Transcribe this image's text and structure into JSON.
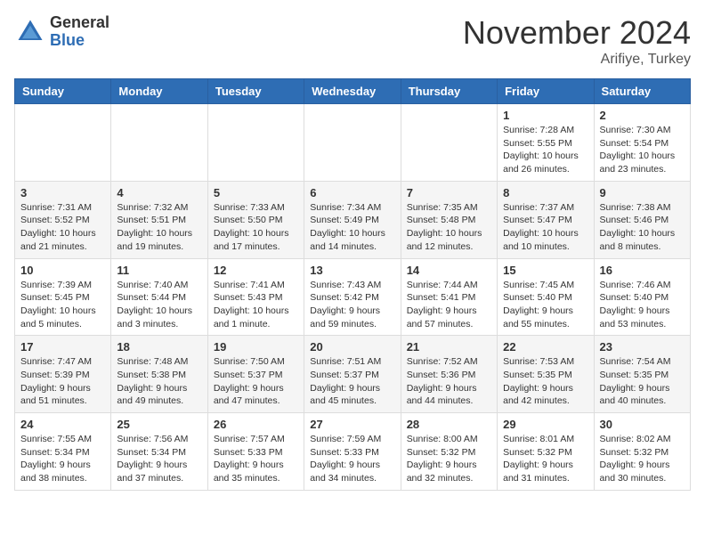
{
  "header": {
    "logo_general": "General",
    "logo_blue": "Blue",
    "month_title": "November 2024",
    "location": "Arifiye, Turkey"
  },
  "days_of_week": [
    "Sunday",
    "Monday",
    "Tuesday",
    "Wednesday",
    "Thursday",
    "Friday",
    "Saturday"
  ],
  "weeks": [
    [
      {
        "day": "",
        "info": ""
      },
      {
        "day": "",
        "info": ""
      },
      {
        "day": "",
        "info": ""
      },
      {
        "day": "",
        "info": ""
      },
      {
        "day": "",
        "info": ""
      },
      {
        "day": "1",
        "info": "Sunrise: 7:28 AM\nSunset: 5:55 PM\nDaylight: 10 hours and 26 minutes."
      },
      {
        "day": "2",
        "info": "Sunrise: 7:30 AM\nSunset: 5:54 PM\nDaylight: 10 hours and 23 minutes."
      }
    ],
    [
      {
        "day": "3",
        "info": "Sunrise: 7:31 AM\nSunset: 5:52 PM\nDaylight: 10 hours and 21 minutes."
      },
      {
        "day": "4",
        "info": "Sunrise: 7:32 AM\nSunset: 5:51 PM\nDaylight: 10 hours and 19 minutes."
      },
      {
        "day": "5",
        "info": "Sunrise: 7:33 AM\nSunset: 5:50 PM\nDaylight: 10 hours and 17 minutes."
      },
      {
        "day": "6",
        "info": "Sunrise: 7:34 AM\nSunset: 5:49 PM\nDaylight: 10 hours and 14 minutes."
      },
      {
        "day": "7",
        "info": "Sunrise: 7:35 AM\nSunset: 5:48 PM\nDaylight: 10 hours and 12 minutes."
      },
      {
        "day": "8",
        "info": "Sunrise: 7:37 AM\nSunset: 5:47 PM\nDaylight: 10 hours and 10 minutes."
      },
      {
        "day": "9",
        "info": "Sunrise: 7:38 AM\nSunset: 5:46 PM\nDaylight: 10 hours and 8 minutes."
      }
    ],
    [
      {
        "day": "10",
        "info": "Sunrise: 7:39 AM\nSunset: 5:45 PM\nDaylight: 10 hours and 5 minutes."
      },
      {
        "day": "11",
        "info": "Sunrise: 7:40 AM\nSunset: 5:44 PM\nDaylight: 10 hours and 3 minutes."
      },
      {
        "day": "12",
        "info": "Sunrise: 7:41 AM\nSunset: 5:43 PM\nDaylight: 10 hours and 1 minute."
      },
      {
        "day": "13",
        "info": "Sunrise: 7:43 AM\nSunset: 5:42 PM\nDaylight: 9 hours and 59 minutes."
      },
      {
        "day": "14",
        "info": "Sunrise: 7:44 AM\nSunset: 5:41 PM\nDaylight: 9 hours and 57 minutes."
      },
      {
        "day": "15",
        "info": "Sunrise: 7:45 AM\nSunset: 5:40 PM\nDaylight: 9 hours and 55 minutes."
      },
      {
        "day": "16",
        "info": "Sunrise: 7:46 AM\nSunset: 5:40 PM\nDaylight: 9 hours and 53 minutes."
      }
    ],
    [
      {
        "day": "17",
        "info": "Sunrise: 7:47 AM\nSunset: 5:39 PM\nDaylight: 9 hours and 51 minutes."
      },
      {
        "day": "18",
        "info": "Sunrise: 7:48 AM\nSunset: 5:38 PM\nDaylight: 9 hours and 49 minutes."
      },
      {
        "day": "19",
        "info": "Sunrise: 7:50 AM\nSunset: 5:37 PM\nDaylight: 9 hours and 47 minutes."
      },
      {
        "day": "20",
        "info": "Sunrise: 7:51 AM\nSunset: 5:37 PM\nDaylight: 9 hours and 45 minutes."
      },
      {
        "day": "21",
        "info": "Sunrise: 7:52 AM\nSunset: 5:36 PM\nDaylight: 9 hours and 44 minutes."
      },
      {
        "day": "22",
        "info": "Sunrise: 7:53 AM\nSunset: 5:35 PM\nDaylight: 9 hours and 42 minutes."
      },
      {
        "day": "23",
        "info": "Sunrise: 7:54 AM\nSunset: 5:35 PM\nDaylight: 9 hours and 40 minutes."
      }
    ],
    [
      {
        "day": "24",
        "info": "Sunrise: 7:55 AM\nSunset: 5:34 PM\nDaylight: 9 hours and 38 minutes."
      },
      {
        "day": "25",
        "info": "Sunrise: 7:56 AM\nSunset: 5:34 PM\nDaylight: 9 hours and 37 minutes."
      },
      {
        "day": "26",
        "info": "Sunrise: 7:57 AM\nSunset: 5:33 PM\nDaylight: 9 hours and 35 minutes."
      },
      {
        "day": "27",
        "info": "Sunrise: 7:59 AM\nSunset: 5:33 PM\nDaylight: 9 hours and 34 minutes."
      },
      {
        "day": "28",
        "info": "Sunrise: 8:00 AM\nSunset: 5:32 PM\nDaylight: 9 hours and 32 minutes."
      },
      {
        "day": "29",
        "info": "Sunrise: 8:01 AM\nSunset: 5:32 PM\nDaylight: 9 hours and 31 minutes."
      },
      {
        "day": "30",
        "info": "Sunrise: 8:02 AM\nSunset: 5:32 PM\nDaylight: 9 hours and 30 minutes."
      }
    ]
  ]
}
